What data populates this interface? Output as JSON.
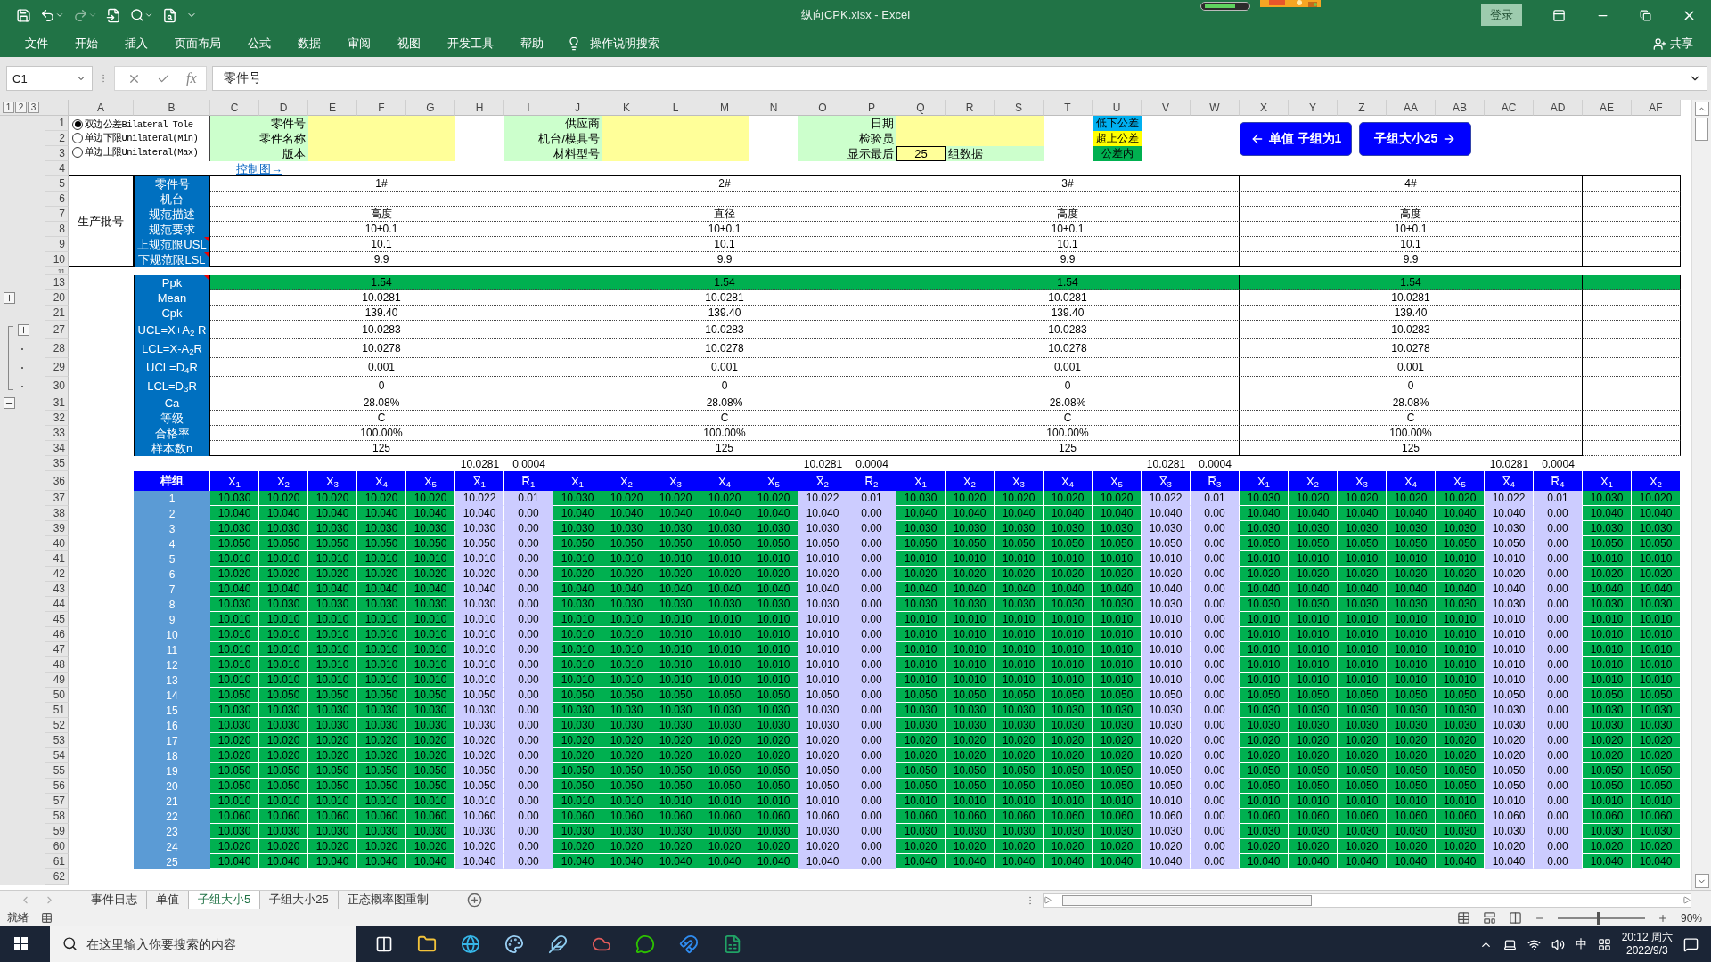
{
  "title_bar": {
    "title": "纵向CPK.xlsx  -  Excel",
    "sign_in": "登录"
  },
  "ribbon_tabs": [
    "文件",
    "开始",
    "插入",
    "页面布局",
    "公式",
    "数据",
    "审阅",
    "视图",
    "开发工具",
    "帮助"
  ],
  "tell_me": "操作说明搜索",
  "share": "共享",
  "formula_bar": {
    "name_box": "C1",
    "function_label": "fx",
    "formula": "零件号"
  },
  "outline_levels": [
    "1",
    "2",
    "3"
  ],
  "columns": [
    "A",
    "B",
    "C",
    "D",
    "E",
    "F",
    "G",
    "H",
    "I",
    "J",
    "K",
    "L",
    "M",
    "N",
    "O",
    "P",
    "Q",
    "R",
    "S",
    "T",
    "U",
    "V",
    "W",
    "X",
    "Y",
    "Z",
    "AA",
    "AB",
    "AC",
    "AD",
    "AE",
    "AF"
  ],
  "header_block": {
    "rows": [
      "1",
      "2",
      "3",
      "4"
    ],
    "tolerance_options": [
      {
        "label": "双边公差Bilateral Tole",
        "selected": true
      },
      {
        "label": "单边下限Unilateral(Min)",
        "selected": false
      },
      {
        "label": "单边上限Unilateral(Max)",
        "selected": false
      }
    ],
    "info_groups": [
      {
        "labels": [
          "零件号",
          "零件名称",
          "版本"
        ]
      },
      {
        "labels": [
          "供应商",
          "机台/模具号",
          "材料型号"
        ]
      },
      {
        "labels": [
          "日期",
          "检验员",
          "显示最后"
        ],
        "last_count": "25",
        "last_suffix": "组数据"
      }
    ],
    "legend": [
      {
        "label": "低下公差",
        "color": "#00b0f0"
      },
      {
        "label": "超上公差",
        "color": "#ffff00"
      },
      {
        "label": "公差内",
        "color": "#00b050"
      }
    ],
    "nav_buttons": [
      {
        "label": "单值 子组为1",
        "kind": "back"
      },
      {
        "label": "子组大小25",
        "kind": "forward"
      }
    ],
    "chart_link": "控制图→"
  },
  "spec": {
    "section_label": "生产批号",
    "gap_row": "11",
    "rows": [
      {
        "row": "5",
        "label": "零件号",
        "values": [
          "1#",
          "2#",
          "3#",
          "4#"
        ],
        "comment": false
      },
      {
        "row": "6",
        "label": "机台",
        "comment": false
      },
      {
        "row": "7",
        "label": "规范描述",
        "values": [
          "高度",
          "直径",
          "高度",
          "高度"
        ],
        "comment": false
      },
      {
        "row": "8",
        "label": "规范要求",
        "values": [
          "10±0.1",
          "10±0.1",
          "10±0.1",
          "10±0.1"
        ],
        "comment": false
      },
      {
        "row": "9",
        "label": "上规范限USL",
        "values": [
          "10.1",
          "10.1",
          "10.1",
          "10.1"
        ],
        "comment": true
      },
      {
        "row": "10",
        "label": "下规范限LSL",
        "values": [
          "9.9",
          "9.9",
          "9.9",
          "9.9"
        ],
        "comment": true
      }
    ]
  },
  "stats": {
    "rows": [
      {
        "row": "13",
        "label": "Ppk",
        "values": [
          "1.54",
          "1.54",
          "1.54",
          "1.54"
        ],
        "comment": true,
        "highlight": true,
        "kind": "plain"
      },
      {
        "row": "20",
        "label": "Mean",
        "values": [
          "10.0281",
          "10.0281",
          "10.0281",
          "10.0281"
        ],
        "comment": false,
        "highlight": false,
        "kind": "expand"
      },
      {
        "row": "21",
        "label": "Cpk",
        "values": [
          "139.40",
          "139.40",
          "139.40",
          "139.40"
        ],
        "comment": false,
        "highlight": false,
        "kind": "plain"
      },
      {
        "row": "27",
        "label": "UCL=X+A$_{2}$ R",
        "values": [
          "10.0283",
          "10.0283",
          "10.0283",
          "10.0283"
        ],
        "comment": false,
        "highlight": false,
        "kind": "expand_inner"
      },
      {
        "row": "28",
        "label": "LCL=X-A$_{2}$R",
        "values": [
          "10.0278",
          "10.0278",
          "10.0278",
          "10.0278"
        ],
        "comment": false,
        "highlight": false,
        "kind": "dot"
      },
      {
        "row": "29",
        "label": "UCL=D$_{4}$R",
        "values": [
          "0.001",
          "0.001",
          "0.001",
          "0.001"
        ],
        "comment": false,
        "highlight": false,
        "kind": "dot"
      },
      {
        "row": "30",
        "label": "LCL=D$_{3}$R",
        "values": [
          "0",
          "0",
          "0",
          "0"
        ],
        "comment": false,
        "highlight": false,
        "kind": "dot"
      },
      {
        "row": "31",
        "label": "Ca",
        "values": [
          "28.08%",
          "28.08%",
          "28.08%",
          "28.08%"
        ],
        "comment": false,
        "highlight": false,
        "kind": "collapse"
      },
      {
        "row": "32",
        "label": "等级",
        "values": [
          "C",
          "C",
          "C",
          "C"
        ],
        "comment": false,
        "highlight": false,
        "kind": "plain"
      },
      {
        "row": "33",
        "label": "合格率",
        "values": [
          "100.00%",
          "100.00%",
          "100.00%",
          "100.00%"
        ],
        "comment": false,
        "highlight": false,
        "kind": "plain"
      },
      {
        "row": "34",
        "label": "样本数n",
        "values": [
          "125",
          "125",
          "125",
          "125"
        ],
        "comment": false,
        "highlight": false,
        "kind": "plain"
      }
    ]
  },
  "samples": {
    "summary_row": "35",
    "summary": [
      [
        "10.0281",
        "0.0004"
      ],
      [
        "10.0281",
        "0.0004"
      ],
      [
        "10.0281",
        "0.0004"
      ],
      [
        "10.0281",
        "0.0004"
      ]
    ],
    "header_row": "36",
    "header_label": "样组",
    "headers": [
      [
        "X$_{1}$",
        "X$_{2}$",
        "X$_{3}$",
        "X$_{4}$",
        "X$_{5}$",
        "X̅$_{1}$",
        "R̅$_{1}$"
      ],
      [
        "X$_{1}$",
        "X$_{2}$",
        "X$_{3}$",
        "X$_{4}$",
        "X$_{5}$",
        "X̅$_{2}$",
        "R̅$_{2}$"
      ],
      [
        "X$_{1}$",
        "X$_{2}$",
        "X$_{3}$",
        "X$_{4}$",
        "X$_{5}$",
        "X̅$_{3}$",
        "R̅$_{3}$"
      ],
      [
        "X$_{1}$",
        "X$_{2}$",
        "X$_{3}$",
        "X$_{4}$",
        "X$_{5}$",
        "X̅$_{4}$",
        "R̅$_{4}$"
      ],
      [
        "X$_{1}$",
        "X$_{2}$"
      ]
    ],
    "rows": [
      {
        "row": "37",
        "label": "1",
        "groups": [
          [
            "10.030",
            "10.020",
            "10.020",
            "10.020",
            "10.020",
            "10.022",
            "0.01"
          ],
          [
            "10.030",
            "10.020",
            "10.020",
            "10.020",
            "10.020",
            "10.022",
            "0.01"
          ],
          [
            "10.030",
            "10.020",
            "10.020",
            "10.020",
            "10.020",
            "10.022",
            "0.01"
          ],
          [
            "10.030",
            "10.020",
            "10.020",
            "10.020",
            "10.020",
            "10.022",
            "0.01"
          ],
          [
            "10.030",
            "10.020"
          ]
        ]
      },
      {
        "row": "38",
        "label": "2",
        "groups": [
          [
            "10.040",
            "10.040",
            "10.040",
            "10.040",
            "10.040",
            "10.040",
            "0.00"
          ],
          [
            "10.040",
            "10.040",
            "10.040",
            "10.040",
            "10.040",
            "10.040",
            "0.00"
          ],
          [
            "10.040",
            "10.040",
            "10.040",
            "10.040",
            "10.040",
            "10.040",
            "0.00"
          ],
          [
            "10.040",
            "10.040",
            "10.040",
            "10.040",
            "10.040",
            "10.040",
            "0.00"
          ],
          [
            "10.040",
            "10.040"
          ]
        ]
      },
      {
        "row": "39",
        "label": "3",
        "groups": [
          [
            "10.030",
            "10.030",
            "10.030",
            "10.030",
            "10.030",
            "10.030",
            "0.00"
          ],
          [
            "10.030",
            "10.030",
            "10.030",
            "10.030",
            "10.030",
            "10.030",
            "0.00"
          ],
          [
            "10.030",
            "10.030",
            "10.030",
            "10.030",
            "10.030",
            "10.030",
            "0.00"
          ],
          [
            "10.030",
            "10.030",
            "10.030",
            "10.030",
            "10.030",
            "10.030",
            "0.00"
          ],
          [
            "10.030",
            "10.030"
          ]
        ]
      },
      {
        "row": "40",
        "label": "4",
        "groups": [
          [
            "10.050",
            "10.050",
            "10.050",
            "10.050",
            "10.050",
            "10.050",
            "0.00"
          ],
          [
            "10.050",
            "10.050",
            "10.050",
            "10.050",
            "10.050",
            "10.050",
            "0.00"
          ],
          [
            "10.050",
            "10.050",
            "10.050",
            "10.050",
            "10.050",
            "10.050",
            "0.00"
          ],
          [
            "10.050",
            "10.050",
            "10.050",
            "10.050",
            "10.050",
            "10.050",
            "0.00"
          ],
          [
            "10.050",
            "10.050"
          ]
        ]
      },
      {
        "row": "41",
        "label": "5",
        "groups": [
          [
            "10.010",
            "10.010",
            "10.010",
            "10.010",
            "10.010",
            "10.010",
            "0.00"
          ],
          [
            "10.010",
            "10.010",
            "10.010",
            "10.010",
            "10.010",
            "10.010",
            "0.00"
          ],
          [
            "10.010",
            "10.010",
            "10.010",
            "10.010",
            "10.010",
            "10.010",
            "0.00"
          ],
          [
            "10.010",
            "10.010",
            "10.010",
            "10.010",
            "10.010",
            "10.010",
            "0.00"
          ],
          [
            "10.010",
            "10.010"
          ]
        ]
      },
      {
        "row": "42",
        "label": "6",
        "groups": [
          [
            "10.020",
            "10.020",
            "10.020",
            "10.020",
            "10.020",
            "10.020",
            "0.00"
          ],
          [
            "10.020",
            "10.020",
            "10.020",
            "10.020",
            "10.020",
            "10.020",
            "0.00"
          ],
          [
            "10.020",
            "10.020",
            "10.020",
            "10.020",
            "10.020",
            "10.020",
            "0.00"
          ],
          [
            "10.020",
            "10.020",
            "10.020",
            "10.020",
            "10.020",
            "10.020",
            "0.00"
          ],
          [
            "10.020",
            "10.020"
          ]
        ]
      },
      {
        "row": "43",
        "label": "7",
        "groups": [
          [
            "10.040",
            "10.040",
            "10.040",
            "10.040",
            "10.040",
            "10.040",
            "0.00"
          ],
          [
            "10.040",
            "10.040",
            "10.040",
            "10.040",
            "10.040",
            "10.040",
            "0.00"
          ],
          [
            "10.040",
            "10.040",
            "10.040",
            "10.040",
            "10.040",
            "10.040",
            "0.00"
          ],
          [
            "10.040",
            "10.040",
            "10.040",
            "10.040",
            "10.040",
            "10.040",
            "0.00"
          ],
          [
            "10.040",
            "10.040"
          ]
        ]
      },
      {
        "row": "44",
        "label": "8",
        "groups": [
          [
            "10.030",
            "10.030",
            "10.030",
            "10.030",
            "10.030",
            "10.030",
            "0.00"
          ],
          [
            "10.030",
            "10.030",
            "10.030",
            "10.030",
            "10.030",
            "10.030",
            "0.00"
          ],
          [
            "10.030",
            "10.030",
            "10.030",
            "10.030",
            "10.030",
            "10.030",
            "0.00"
          ],
          [
            "10.030",
            "10.030",
            "10.030",
            "10.030",
            "10.030",
            "10.030",
            "0.00"
          ],
          [
            "10.030",
            "10.030"
          ]
        ]
      },
      {
        "row": "45",
        "label": "9",
        "groups": [
          [
            "10.010",
            "10.010",
            "10.010",
            "10.010",
            "10.010",
            "10.010",
            "0.00"
          ],
          [
            "10.010",
            "10.010",
            "10.010",
            "10.010",
            "10.010",
            "10.010",
            "0.00"
          ],
          [
            "10.010",
            "10.010",
            "10.010",
            "10.010",
            "10.010",
            "10.010",
            "0.00"
          ],
          [
            "10.010",
            "10.010",
            "10.010",
            "10.010",
            "10.010",
            "10.010",
            "0.00"
          ],
          [
            "10.010",
            "10.010"
          ]
        ]
      },
      {
        "row": "46",
        "label": "10",
        "groups": [
          [
            "10.010",
            "10.010",
            "10.010",
            "10.010",
            "10.010",
            "10.010",
            "0.00"
          ],
          [
            "10.010",
            "10.010",
            "10.010",
            "10.010",
            "10.010",
            "10.010",
            "0.00"
          ],
          [
            "10.010",
            "10.010",
            "10.010",
            "10.010",
            "10.010",
            "10.010",
            "0.00"
          ],
          [
            "10.010",
            "10.010",
            "10.010",
            "10.010",
            "10.010",
            "10.010",
            "0.00"
          ],
          [
            "10.010",
            "10.010"
          ]
        ]
      },
      {
        "row": "47",
        "label": "11",
        "groups": [
          [
            "10.010",
            "10.010",
            "10.010",
            "10.010",
            "10.010",
            "10.010",
            "0.00"
          ],
          [
            "10.010",
            "10.010",
            "10.010",
            "10.010",
            "10.010",
            "10.010",
            "0.00"
          ],
          [
            "10.010",
            "10.010",
            "10.010",
            "10.010",
            "10.010",
            "10.010",
            "0.00"
          ],
          [
            "10.010",
            "10.010",
            "10.010",
            "10.010",
            "10.010",
            "10.010",
            "0.00"
          ],
          [
            "10.010",
            "10.010"
          ]
        ]
      },
      {
        "row": "48",
        "label": "12",
        "groups": [
          [
            "10.010",
            "10.010",
            "10.010",
            "10.010",
            "10.010",
            "10.010",
            "0.00"
          ],
          [
            "10.010",
            "10.010",
            "10.010",
            "10.010",
            "10.010",
            "10.010",
            "0.00"
          ],
          [
            "10.010",
            "10.010",
            "10.010",
            "10.010",
            "10.010",
            "10.010",
            "0.00"
          ],
          [
            "10.010",
            "10.010",
            "10.010",
            "10.010",
            "10.010",
            "10.010",
            "0.00"
          ],
          [
            "10.010",
            "10.010"
          ]
        ]
      },
      {
        "row": "49",
        "label": "13",
        "groups": [
          [
            "10.010",
            "10.010",
            "10.010",
            "10.010",
            "10.010",
            "10.010",
            "0.00"
          ],
          [
            "10.010",
            "10.010",
            "10.010",
            "10.010",
            "10.010",
            "10.010",
            "0.00"
          ],
          [
            "10.010",
            "10.010",
            "10.010",
            "10.010",
            "10.010",
            "10.010",
            "0.00"
          ],
          [
            "10.010",
            "10.010",
            "10.010",
            "10.010",
            "10.010",
            "10.010",
            "0.00"
          ],
          [
            "10.010",
            "10.010"
          ]
        ]
      },
      {
        "row": "50",
        "label": "14",
        "groups": [
          [
            "10.050",
            "10.050",
            "10.050",
            "10.050",
            "10.050",
            "10.050",
            "0.00"
          ],
          [
            "10.050",
            "10.050",
            "10.050",
            "10.050",
            "10.050",
            "10.050",
            "0.00"
          ],
          [
            "10.050",
            "10.050",
            "10.050",
            "10.050",
            "10.050",
            "10.050",
            "0.00"
          ],
          [
            "10.050",
            "10.050",
            "10.050",
            "10.050",
            "10.050",
            "10.050",
            "0.00"
          ],
          [
            "10.050",
            "10.050"
          ]
        ]
      },
      {
        "row": "51",
        "label": "15",
        "groups": [
          [
            "10.030",
            "10.030",
            "10.030",
            "10.030",
            "10.030",
            "10.030",
            "0.00"
          ],
          [
            "10.030",
            "10.030",
            "10.030",
            "10.030",
            "10.030",
            "10.030",
            "0.00"
          ],
          [
            "10.030",
            "10.030",
            "10.030",
            "10.030",
            "10.030",
            "10.030",
            "0.00"
          ],
          [
            "10.030",
            "10.030",
            "10.030",
            "10.030",
            "10.030",
            "10.030",
            "0.00"
          ],
          [
            "10.030",
            "10.030"
          ]
        ]
      },
      {
        "row": "52",
        "label": "16",
        "groups": [
          [
            "10.030",
            "10.030",
            "10.030",
            "10.030",
            "10.030",
            "10.030",
            "0.00"
          ],
          [
            "10.030",
            "10.030",
            "10.030",
            "10.030",
            "10.030",
            "10.030",
            "0.00"
          ],
          [
            "10.030",
            "10.030",
            "10.030",
            "10.030",
            "10.030",
            "10.030",
            "0.00"
          ],
          [
            "10.030",
            "10.030",
            "10.030",
            "10.030",
            "10.030",
            "10.030",
            "0.00"
          ],
          [
            "10.030",
            "10.030"
          ]
        ]
      },
      {
        "row": "53",
        "label": "17",
        "groups": [
          [
            "10.020",
            "10.020",
            "10.020",
            "10.020",
            "10.020",
            "10.020",
            "0.00"
          ],
          [
            "10.020",
            "10.020",
            "10.020",
            "10.020",
            "10.020",
            "10.020",
            "0.00"
          ],
          [
            "10.020",
            "10.020",
            "10.020",
            "10.020",
            "10.020",
            "10.020",
            "0.00"
          ],
          [
            "10.020",
            "10.020",
            "10.020",
            "10.020",
            "10.020",
            "10.020",
            "0.00"
          ],
          [
            "10.020",
            "10.020"
          ]
        ]
      },
      {
        "row": "54",
        "label": "18",
        "groups": [
          [
            "10.020",
            "10.020",
            "10.020",
            "10.020",
            "10.020",
            "10.020",
            "0.00"
          ],
          [
            "10.020",
            "10.020",
            "10.020",
            "10.020",
            "10.020",
            "10.020",
            "0.00"
          ],
          [
            "10.020",
            "10.020",
            "10.020",
            "10.020",
            "10.020",
            "10.020",
            "0.00"
          ],
          [
            "10.020",
            "10.020",
            "10.020",
            "10.020",
            "10.020",
            "10.020",
            "0.00"
          ],
          [
            "10.020",
            "10.020"
          ]
        ]
      },
      {
        "row": "55",
        "label": "19",
        "groups": [
          [
            "10.050",
            "10.050",
            "10.050",
            "10.050",
            "10.050",
            "10.050",
            "0.00"
          ],
          [
            "10.050",
            "10.050",
            "10.050",
            "10.050",
            "10.050",
            "10.050",
            "0.00"
          ],
          [
            "10.050",
            "10.050",
            "10.050",
            "10.050",
            "10.050",
            "10.050",
            "0.00"
          ],
          [
            "10.050",
            "10.050",
            "10.050",
            "10.050",
            "10.050",
            "10.050",
            "0.00"
          ],
          [
            "10.050",
            "10.050"
          ]
        ]
      },
      {
        "row": "56",
        "label": "20",
        "groups": [
          [
            "10.050",
            "10.050",
            "10.050",
            "10.050",
            "10.050",
            "10.050",
            "0.00"
          ],
          [
            "10.050",
            "10.050",
            "10.050",
            "10.050",
            "10.050",
            "10.050",
            "0.00"
          ],
          [
            "10.050",
            "10.050",
            "10.050",
            "10.050",
            "10.050",
            "10.050",
            "0.00"
          ],
          [
            "10.050",
            "10.050",
            "10.050",
            "10.050",
            "10.050",
            "10.050",
            "0.00"
          ],
          [
            "10.050",
            "10.050"
          ]
        ]
      },
      {
        "row": "57",
        "label": "21",
        "groups": [
          [
            "10.010",
            "10.010",
            "10.010",
            "10.010",
            "10.010",
            "10.010",
            "0.00"
          ],
          [
            "10.010",
            "10.010",
            "10.010",
            "10.010",
            "10.010",
            "10.010",
            "0.00"
          ],
          [
            "10.010",
            "10.010",
            "10.010",
            "10.010",
            "10.010",
            "10.010",
            "0.00"
          ],
          [
            "10.010",
            "10.010",
            "10.010",
            "10.010",
            "10.010",
            "10.010",
            "0.00"
          ],
          [
            "10.010",
            "10.010"
          ]
        ]
      },
      {
        "row": "58",
        "label": "22",
        "groups": [
          [
            "10.060",
            "10.060",
            "10.060",
            "10.060",
            "10.060",
            "10.060",
            "0.00"
          ],
          [
            "10.060",
            "10.060",
            "10.060",
            "10.060",
            "10.060",
            "10.060",
            "0.00"
          ],
          [
            "10.060",
            "10.060",
            "10.060",
            "10.060",
            "10.060",
            "10.060",
            "0.00"
          ],
          [
            "10.060",
            "10.060",
            "10.060",
            "10.060",
            "10.060",
            "10.060",
            "0.00"
          ],
          [
            "10.060",
            "10.060"
          ]
        ]
      },
      {
        "row": "59",
        "label": "23",
        "groups": [
          [
            "10.030",
            "10.030",
            "10.030",
            "10.030",
            "10.030",
            "10.030",
            "0.00"
          ],
          [
            "10.030",
            "10.030",
            "10.030",
            "10.030",
            "10.030",
            "10.030",
            "0.00"
          ],
          [
            "10.030",
            "10.030",
            "10.030",
            "10.030",
            "10.030",
            "10.030",
            "0.00"
          ],
          [
            "10.030",
            "10.030",
            "10.030",
            "10.030",
            "10.030",
            "10.030",
            "0.00"
          ],
          [
            "10.030",
            "10.030"
          ]
        ]
      },
      {
        "row": "60",
        "label": "24",
        "groups": [
          [
            "10.020",
            "10.020",
            "10.020",
            "10.020",
            "10.020",
            "10.020",
            "0.00"
          ],
          [
            "10.020",
            "10.020",
            "10.020",
            "10.020",
            "10.020",
            "10.020",
            "0.00"
          ],
          [
            "10.020",
            "10.020",
            "10.020",
            "10.020",
            "10.020",
            "10.020",
            "0.00"
          ],
          [
            "10.020",
            "10.020",
            "10.020",
            "10.020",
            "10.020",
            "10.020",
            "0.00"
          ],
          [
            "10.020",
            "10.020"
          ]
        ]
      },
      {
        "row": "61",
        "label": "25",
        "groups": [
          [
            "10.040",
            "10.040",
            "10.040",
            "10.040",
            "10.040",
            "10.040",
            "0.00"
          ],
          [
            "10.040",
            "10.040",
            "10.040",
            "10.040",
            "10.040",
            "10.040",
            "0.00"
          ],
          [
            "10.040",
            "10.040",
            "10.040",
            "10.040",
            "10.040",
            "10.040",
            "0.00"
          ],
          [
            "10.040",
            "10.040",
            "10.040",
            "10.040",
            "10.040",
            "10.040",
            "0.00"
          ],
          [
            "10.040",
            "10.040"
          ]
        ]
      }
    ],
    "blank_row": "62"
  },
  "sheet_tabs": [
    {
      "label": "事件日志",
      "selected": false
    },
    {
      "label": "单值",
      "selected": false
    },
    {
      "label": "子组大小5",
      "selected": true
    },
    {
      "label": "子组大小25",
      "selected": false
    },
    {
      "label": "正态概率图重制",
      "selected": false
    }
  ],
  "status_bar": {
    "ready": "就绪",
    "zoom": {
      "level": 0.47,
      "reading": "90%"
    }
  },
  "taskbar": {
    "search_placeholder": "在这里输入你要搜索的内容",
    "ime": "中",
    "time": "20:12 周六",
    "date": "2022/9/3"
  }
}
